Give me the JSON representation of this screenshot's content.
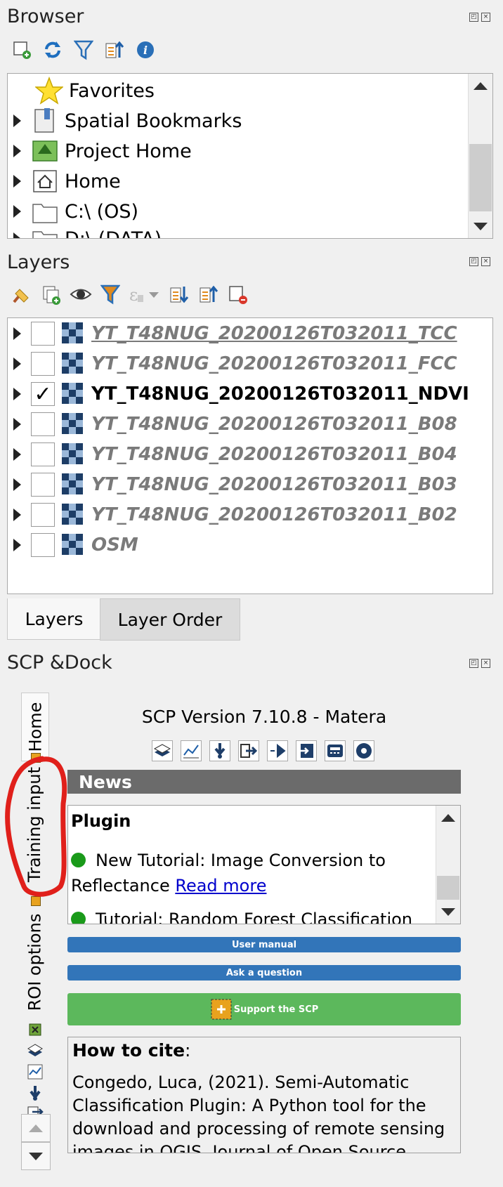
{
  "browser": {
    "title": "Browser",
    "toolbar": [
      "add-selected-layers-icon",
      "refresh-icon",
      "filter-browser-icon",
      "collapse-all-icon",
      "properties-info-icon"
    ],
    "items": [
      {
        "label": "Favorites",
        "icon": "favorites-star-icon",
        "expandable": false
      },
      {
        "label": "Spatial Bookmarks",
        "icon": "bookmarks-icon",
        "expandable": true
      },
      {
        "label": "Project Home",
        "icon": "project-home-icon",
        "expandable": true
      },
      {
        "label": "Home",
        "icon": "home-icon",
        "expandable": true
      },
      {
        "label": "C:\\ (OS)",
        "icon": "folder-icon",
        "expandable": true
      },
      {
        "label": "D:\\ (DATA)",
        "icon": "folder-icon",
        "expandable": true
      }
    ]
  },
  "layers": {
    "title": "Layers",
    "toolbar": [
      "style-manager-icon",
      "add-group-icon",
      "manage-visibility-icon",
      "filter-legend-icon",
      "filter-expression-icon",
      "expand-all-icon",
      "collapse-all-icon",
      "remove-layer-icon"
    ],
    "items": [
      {
        "name": "YT_T48NUG_20200126T032011_TCC",
        "checked": false,
        "underline": true
      },
      {
        "name": "YT_T48NUG_20200126T032011_FCC",
        "checked": false,
        "underline": false
      },
      {
        "name": "YT_T48NUG_20200126T032011_NDVI",
        "checked": true,
        "underline": false
      },
      {
        "name": "YT_T48NUG_20200126T032011_B08",
        "checked": false,
        "underline": false
      },
      {
        "name": "YT_T48NUG_20200126T032011_B04",
        "checked": false,
        "underline": false
      },
      {
        "name": "YT_T48NUG_20200126T032011_B03",
        "checked": false,
        "underline": false
      },
      {
        "name": "YT_T48NUG_20200126T032011_B02",
        "checked": false,
        "underline": false
      },
      {
        "name": "OSM",
        "checked": false,
        "underline": false
      }
    ],
    "check_mark": "✓",
    "tabs": [
      "Layers",
      "Layer Order"
    ]
  },
  "scp": {
    "title": "SCP &Dock",
    "vertical_tabs": [
      "Home",
      "Training input",
      "ROI options"
    ],
    "version": "SCP Version 7.10.8 - Matera",
    "news_header": "News",
    "news": {
      "section": "Plugin",
      "item1_text": "New Tutorial: Image Conversion to Reflectance ",
      "item1_link": "Read more",
      "item2_text": "Tutorial: Random Forest Classification"
    },
    "user_manual": "User manual",
    "ask_question": "Ask a question",
    "support": "Support the SCP",
    "cite_title": "How to cite",
    "cite_colon": ":",
    "cite_text": "Congedo, Luca, (2021). Semi-Automatic Classification Plugin: A Python tool for the download and processing of remote sensing images in QGIS. Journal of Open Source"
  },
  "colors": {
    "news_header_bg": "#6b6b6b",
    "button_blue": "#3275b9",
    "button_green": "#5cb85c",
    "annotation_red": "#e0201b"
  }
}
